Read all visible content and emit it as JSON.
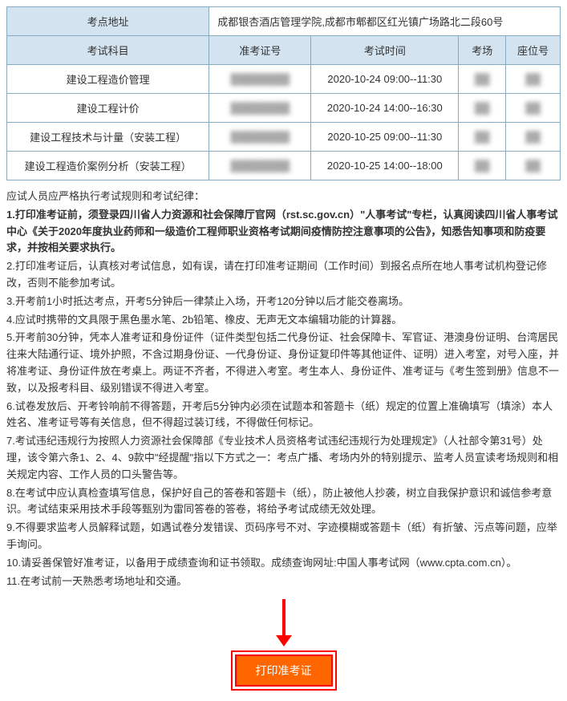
{
  "address_label": "考点地址",
  "address_value": "成都银杏酒店管理学院,成都市郫都区红光镇广场路北二段60号",
  "headers": {
    "subject": "考试科目",
    "ticket": "准考证号",
    "time": "考试时间",
    "room": "考场",
    "seat": "座位号"
  },
  "rows": [
    {
      "subject": "建设工程造价管理",
      "ticket": "████████",
      "time": "2020-10-24 09:00--11:30",
      "room": "██",
      "seat": "██"
    },
    {
      "subject": "建设工程计价",
      "ticket": "████████",
      "time": "2020-10-24 14:00--16:30",
      "room": "██",
      "seat": "██"
    },
    {
      "subject": "建设工程技术与计量（安装工程）",
      "ticket": "████████",
      "time": "2020-10-25 09:00--11:30",
      "room": "██",
      "seat": "██"
    },
    {
      "subject": "建设工程造价案例分析（安装工程）",
      "ticket": "████████",
      "time": "2020-10-25 14:00--18:00",
      "room": "██",
      "seat": "██"
    }
  ],
  "instr": {
    "intro": "应试人员应严格执行考试规则和考试纪律：",
    "p1": "1.打印准考证前，须登录四川省人力资源和社会保障厅官网（rst.sc.gov.cn）\"人事考试\"专栏，认真阅读四川省人事考试中心《关于2020年度执业药师和一级造价工程师职业资格考试期间疫情防控注意事项的公告》，知悉告知事项和防疫要求，并按相关要求执行。",
    "p2": "2.打印准考证后，认真核对考试信息，如有误，请在打印准考证期间（工作时间）到报名点所在地人事考试机构登记修改，否则不能参加考试。",
    "p3": "3.开考前1小时抵达考点，开考5分钟后一律禁止入场，开考120分钟以后才能交卷离场。",
    "p4": "4.应试时携带的文具限于黑色墨水笔、2b铅笔、橡皮、无声无文本编辑功能的计算器。",
    "p5": "5.开考前30分钟，凭本人准考证和身份证件（证件类型包括二代身份证、社会保障卡、军官证、港澳身份证明、台湾居民往来大陆通行证、境外护照，不含过期身份证、一代身份证、身份证复印件等其他证件、证明）进入考室，对号入座，并将准考证、身份证件放在考桌上。两证不齐者，不得进入考室。考生本人、身份证件、准考证与《考生签到册》信息不一致，以及报考科目、级别错误不得进入考室。",
    "p6": "6.试卷发放后、开考铃响前不得答题，开考后5分钟内必须在试题本和答题卡（纸）规定的位置上准确填写（填涂）本人姓名、准考证号等有关信息，但不得超过装订线，不得做任何标记。",
    "p7": "7.考试违纪违规行为按照人力资源社会保障部《专业技术人员资格考试违纪违规行为处理规定》（人社部令第31号）处理，该令第六条1、2、4、9款中\"经提醒\"指以下方式之一：考点广播、考场内外的特别提示、监考人员宣读考场规则和相关规定内容、工作人员的口头警告等。",
    "p8": "8.在考试中应认真检查填写信息，保护好自己的答卷和答题卡（纸），防止被他人抄袭，树立自我保护意识和诚信参考意识。考试结束采用技术手段等甄别为雷同答卷的答卷，将给予考试成绩无效处理。",
    "p9": "9.不得要求监考人员解释试题，如遇试卷分发错误、页码序号不对、字迹模糊或答题卡（纸）有折皱、污点等问题，应举手询问。",
    "p10": "10.请妥善保管好准考证，以备用于成绩查询和证书领取。成绩查询网址:中国人事考试网（www.cpta.com.cn）。",
    "p11": "11.在考试前一天熟悉考场地址和交通。"
  },
  "button_label": "打印准考证"
}
